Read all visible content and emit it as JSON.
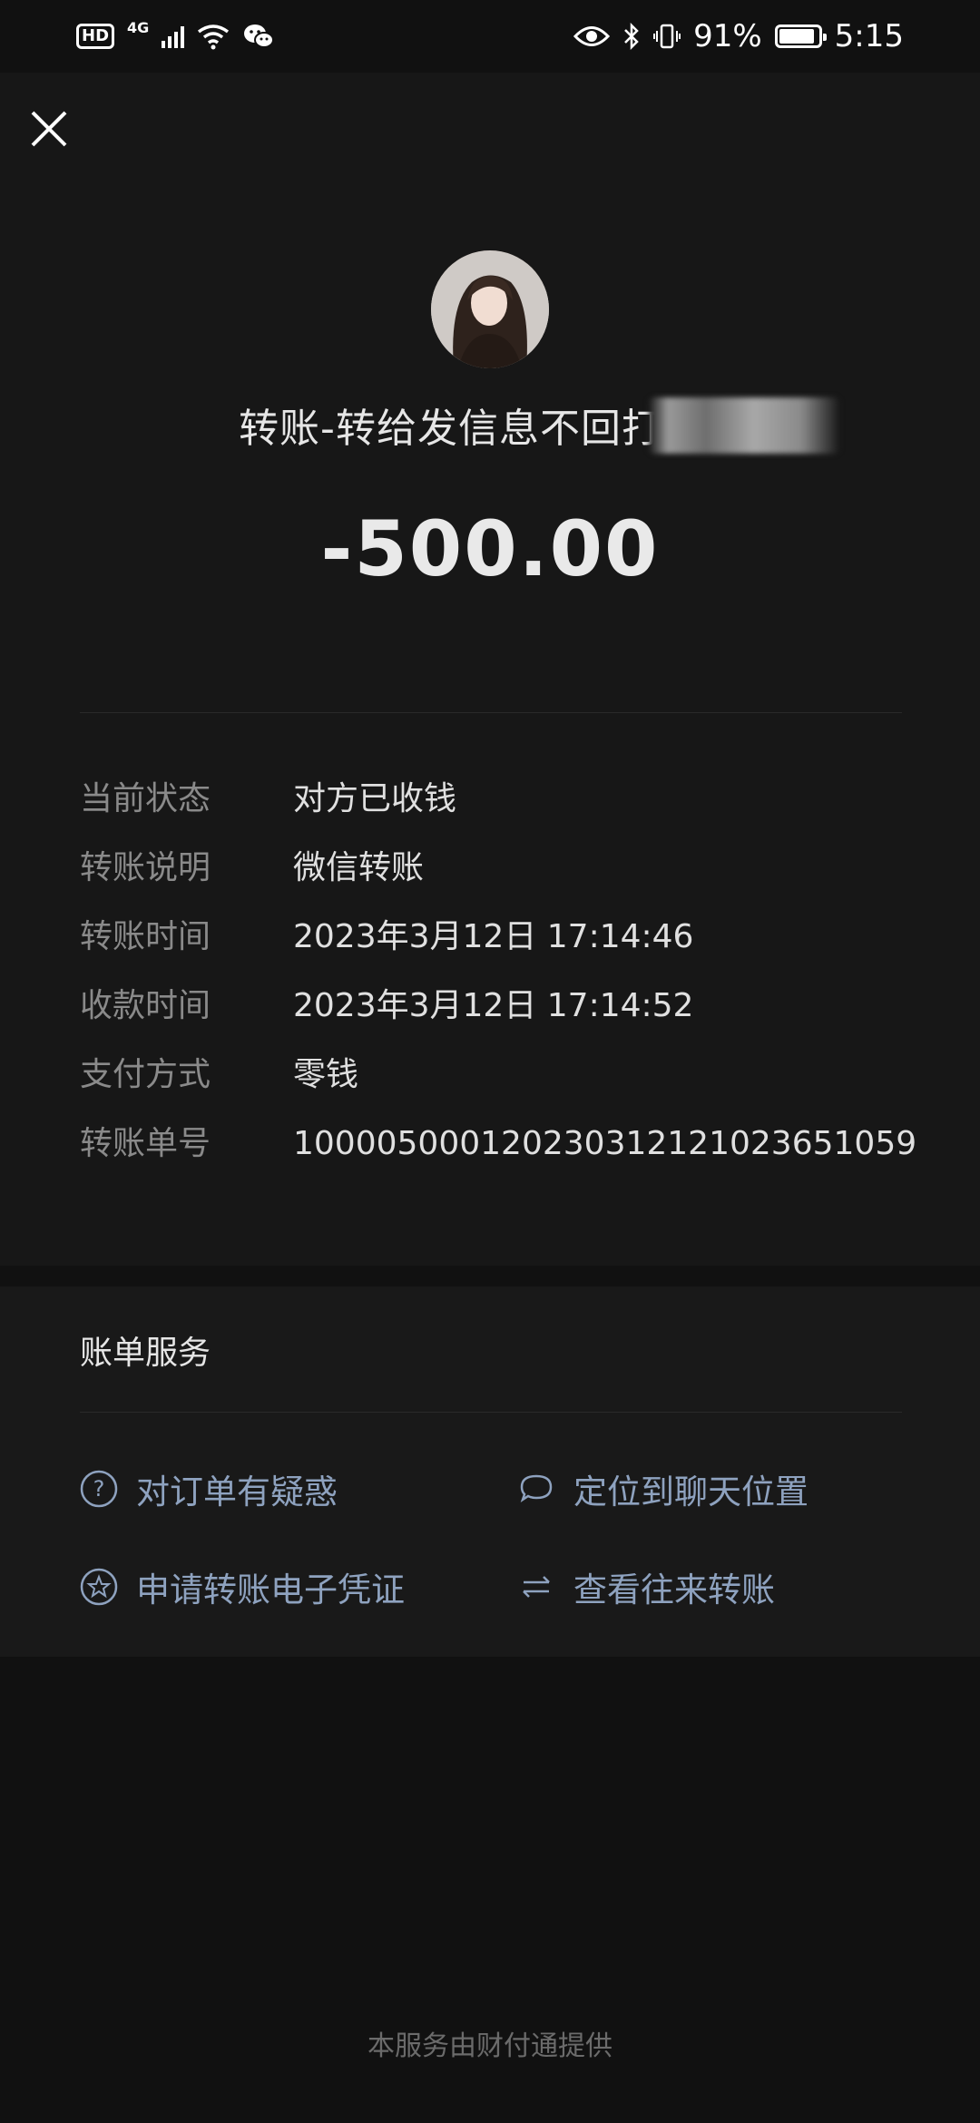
{
  "status_bar": {
    "network": "4G",
    "hd": "HD",
    "battery": "91%",
    "battery_level": 0.91,
    "time": "5:15"
  },
  "header": {
    "title": "转账-转给发信息不回打137",
    "amount": "-500.00"
  },
  "details": [
    {
      "label": "当前状态",
      "value": "对方已收钱"
    },
    {
      "label": "转账说明",
      "value": "微信转账"
    },
    {
      "label": "转账时间",
      "value": "2023年3月12日 17:14:46"
    },
    {
      "label": "收款时间",
      "value": "2023年3月12日 17:14:52"
    },
    {
      "label": "支付方式",
      "value": "零钱"
    },
    {
      "label": "转账单号",
      "value": "100005000120230312121023651059"
    }
  ],
  "services": {
    "title": "账单服务",
    "items": [
      {
        "label": "对订单有疑惑",
        "icon": "question-icon"
      },
      {
        "label": "定位到聊天位置",
        "icon": "chat-bubble-icon"
      },
      {
        "label": "申请转账电子凭证",
        "icon": "star-badge-icon"
      },
      {
        "label": "查看往来转账",
        "icon": "swap-arrows-icon"
      }
    ]
  },
  "footer": "本服务由财付通提供",
  "colors": {
    "background": "#111111",
    "section": "#171717",
    "link": "#8ea2bf"
  }
}
